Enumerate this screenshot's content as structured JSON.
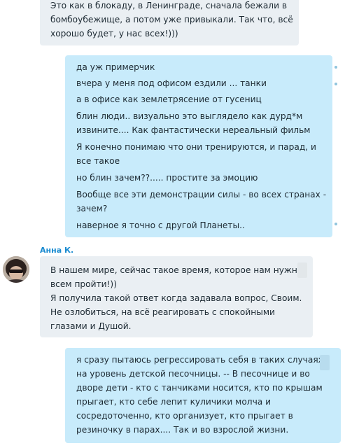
{
  "messages": [
    {
      "direction": "incoming",
      "lines": [
        "Это как в блокаду, в Ленинграде, сначала бежали в",
        "бомбоубежище, а потом уже привыкали. Так что, всё",
        "хорошо будет, у нас всех!)))"
      ]
    },
    {
      "direction": "outgoing",
      "lines": [
        "да уж примерчик",
        "вчера у меня под офисом ездили ... танки",
        "а в офисе как землетрясение от гусениц",
        "блин люди.. визуально это выглядело как дурд*м",
        "извините.... Как фантастически нереальный фильм",
        "Я конечно понимаю что они тренируются, и парад, и",
        "все такое",
        "но блин зачем??.....  простите за эмоцию",
        "Вообще все эти демонстрации силы - во всех странах -",
        "зачем?",
        "наверное я точно с другой Планеты.."
      ]
    },
    {
      "direction": "incoming",
      "sender": "Анна К.",
      "lines": [
        "В нашем мире, сейчас такое время, которое нам нужно",
        "всем пройти!))",
        "Я получила такой ответ когда задавала вопрос, Своим.",
        "Не озлобиться, на всё реагировать с спокойными",
        "глазами и Душой."
      ]
    },
    {
      "direction": "outgoing",
      "lines": [
        "я сразу пытаюсь регрессировать себя в таких случаях",
        "на уровень детской песочницы. -- В песочнице и во",
        "дворе дети - кто с танчиками носится, кто по крышам",
        "прыгает, кто себе лепит куличики молча и",
        "сосредоточенно, кто организует, кто прыгает в",
        "резиночку в парах.... Так и во взрослой жизни."
      ]
    }
  ]
}
